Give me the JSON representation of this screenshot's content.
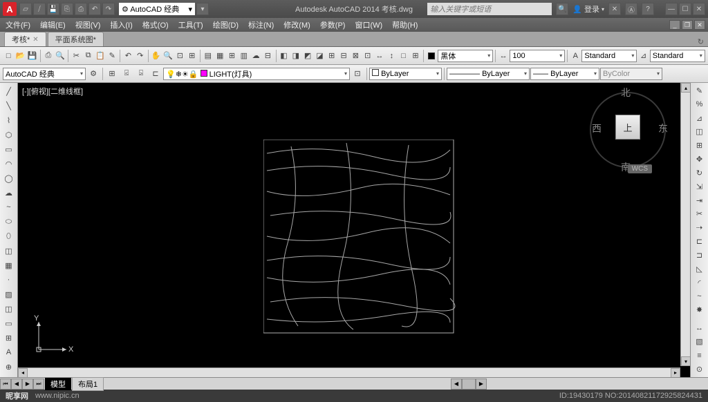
{
  "app": {
    "title_full": "Autodesk AutoCAD 2014    考核.dwg",
    "logo_letter": "A"
  },
  "qat_icons": [
    "new",
    "open",
    "save",
    "saveas",
    "plot",
    "undo",
    "redo"
  ],
  "workspace": {
    "label": "AutoCAD 经典",
    "dd_arrow": "▾"
  },
  "search": {
    "placeholder": "输入关键字或短语"
  },
  "user": {
    "login_label": "登录",
    "icon": "👤"
  },
  "cloud_icons": [
    "✕",
    "Ⓐ",
    "?"
  ],
  "window_controls": [
    "—",
    "☐",
    "✕"
  ],
  "menus": [
    "文件(F)",
    "编辑(E)",
    "视图(V)",
    "插入(I)",
    "格式(O)",
    "工具(T)",
    "绘图(D)",
    "标注(N)",
    "修改(M)",
    "参数(P)",
    "窗口(W)",
    "帮助(H)"
  ],
  "tabs": [
    {
      "label": "考核*",
      "active": true
    },
    {
      "label": "平面系统图*",
      "active": false
    }
  ],
  "toolbar1": {
    "groups": [
      [
        "□",
        "▭",
        "▢",
        "⎘",
        "✂",
        "⧉",
        "↶",
        "↷",
        "✎",
        "⤢",
        "⤡",
        "◫",
        "◪",
        "H",
        "≡"
      ],
      [
        "◧",
        "◨",
        "◩",
        "◪",
        "⊞",
        "⊟",
        "⊠",
        "⊡",
        "↔",
        "↕",
        "□",
        "⊞"
      ]
    ],
    "color": {
      "label": "黑体",
      "swatch": "#000"
    },
    "scale_btn": "↔",
    "scale": "100",
    "textstyle_btn": "A",
    "textstyle": "Standard",
    "dimstyle_btn": "⊿",
    "dimstyle": "Standard"
  },
  "toolbar2": {
    "workspace_label": "AutoCAD 经典",
    "gear_btn": "⚙",
    "mid_btns": [
      "⊞",
      "⍃",
      "⍄",
      "⊏"
    ],
    "layer_swatch": "#ff00ff",
    "layer": "LIGHT(灯具)",
    "layer_tool_btn": "⊡",
    "bylayer_color": {
      "label": "ByLayer",
      "swatch": "#fff"
    },
    "linetype": {
      "sample": "————",
      "label": "ByLayer"
    },
    "lineweight": {
      "sample": "——",
      "label": "ByLayer"
    },
    "plotstyle": "ByColor"
  },
  "canvas": {
    "view_label": "[-][俯视][二维线框]",
    "viewcube": {
      "top": "上",
      "n": "北",
      "s": "南",
      "e": "东",
      "w": "西",
      "wcs": "WCS"
    },
    "axes": {
      "x": "X",
      "y": "Y"
    }
  },
  "layout": {
    "nav": [
      "⏮",
      "◀",
      "▶",
      "⏭"
    ],
    "tabs": [
      {
        "label": "模型",
        "active": true
      },
      {
        "label": "布局1",
        "active": false
      }
    ],
    "mid_nav": [
      "◀",
      "▶"
    ]
  },
  "left_tools": [
    "╱",
    "╱",
    "⌒",
    "⌇",
    "◯",
    "◠",
    "⬭",
    "~",
    "⬯",
    "::",
    "◫",
    "▭",
    "◫",
    "▦",
    "⊞",
    "◉",
    "A"
  ],
  "right_tools": [
    "✎",
    "%",
    "⊿",
    "◫",
    "+",
    "↻",
    "⇨",
    "□",
    "⊡",
    "▤",
    "-",
    "/",
    "⊏",
    "÷",
    "◫",
    "⊡",
    "⊞",
    "▦",
    "◧",
    "◨",
    "◩",
    "⋯"
  ],
  "footer": {
    "site_cn": "昵享网",
    "site_url": "www.nipic.cn",
    "id_label": "ID:19430179 NO:20140821172925824431"
  }
}
